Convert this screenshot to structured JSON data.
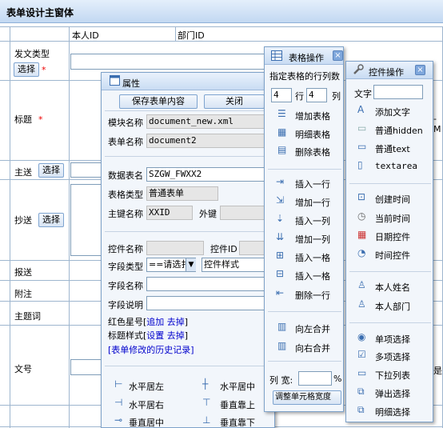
{
  "window": {
    "title": "表单设计主窗体"
  },
  "form": {
    "header": {
      "col1": "本人ID",
      "col2": "部门ID"
    },
    "rows": [
      {
        "label": "发文类型",
        "button": "选择",
        "required": "*"
      },
      {
        "label": "标题",
        "required": "*"
      },
      {
        "label": "主送",
        "button": "选择"
      },
      {
        "label": "抄送",
        "button": "选择"
      },
      {
        "label": "报送"
      },
      {
        "label": "附注"
      },
      {
        "label": "主题词"
      },
      {
        "label": "文号"
      }
    ],
    "right_edge_text": "-M",
    "right_edge_text2": "是"
  },
  "attr_panel": {
    "title": "属性",
    "save_btn": "保存表单内容",
    "close_btn": "关闭",
    "module_label": "模块名称",
    "module_value": "document_new.xml",
    "table_label": "表单名称",
    "table_value": "document2",
    "dbtable_label": "数据表名",
    "dbtable_value": "SZGW_FWXX2",
    "tabletype_label": "表格类型",
    "tabletype_value": "普通表单",
    "pk_label": "主键名称",
    "pk_value": "XXID",
    "fk_label": "外键",
    "ctrlname_label": "控件名称",
    "ctrlid_label": "控件ID",
    "fieldtype_label": "字段类型",
    "fieldtype_value": "==请选扌",
    "ctrlstyle_value": "控件样式",
    "fieldname_label": "字段名称",
    "fielddesc_label": "字段说明",
    "redstar_text": "红色星号",
    "redstar_add": "追加",
    "redstar_remove": "去掉",
    "titlestyle_text": "标题样式",
    "titlestyle_set": "设置",
    "titlestyle_remove": "去掉",
    "history_link": "表单修改的历史记录",
    "align": {
      "left": "水平居左",
      "hcenter": "水平居中",
      "right": "水平居右",
      "top": "垂直靠上",
      "vcenter": "垂直居中",
      "bottom": "垂直靠下"
    }
  },
  "table_panel": {
    "title": "表格操作",
    "subtitle": "指定表格的行列数",
    "rows_value": "4",
    "rows_unit": "行",
    "cols_value": "4",
    "cols_unit": "列",
    "items": [
      "增加表格",
      "明细表格",
      "删除表格"
    ],
    "items2": [
      "插入一行",
      "增加一行",
      "插入一列",
      "增加一列",
      "插入一格",
      "插入一格",
      "删除一行"
    ],
    "items3": [
      "向左合并",
      "向右合并"
    ],
    "width_label": "列 宽:",
    "width_unit": "%",
    "adjust_btn": "调整单元格宽度"
  },
  "ctrl_panel": {
    "title": "控件操作",
    "text_label": "文字",
    "items": [
      "添加文字",
      "普通hidden",
      "普通text",
      "textarea"
    ],
    "items2": [
      "创建时间",
      "当前时间",
      "日期控件",
      "时间控件"
    ],
    "items3": [
      "本人姓名",
      "本人部门"
    ],
    "items4": [
      "单项选择",
      "多项选择",
      "下拉列表",
      "弹出选择",
      "明细选择"
    ]
  },
  "colors": {
    "accent": "#7ea2c9",
    "required": "#e00000",
    "link": "#0000cc"
  },
  "icons": [
    "window-icon",
    "table-icon",
    "wrench-icon",
    "close-icon"
  ]
}
